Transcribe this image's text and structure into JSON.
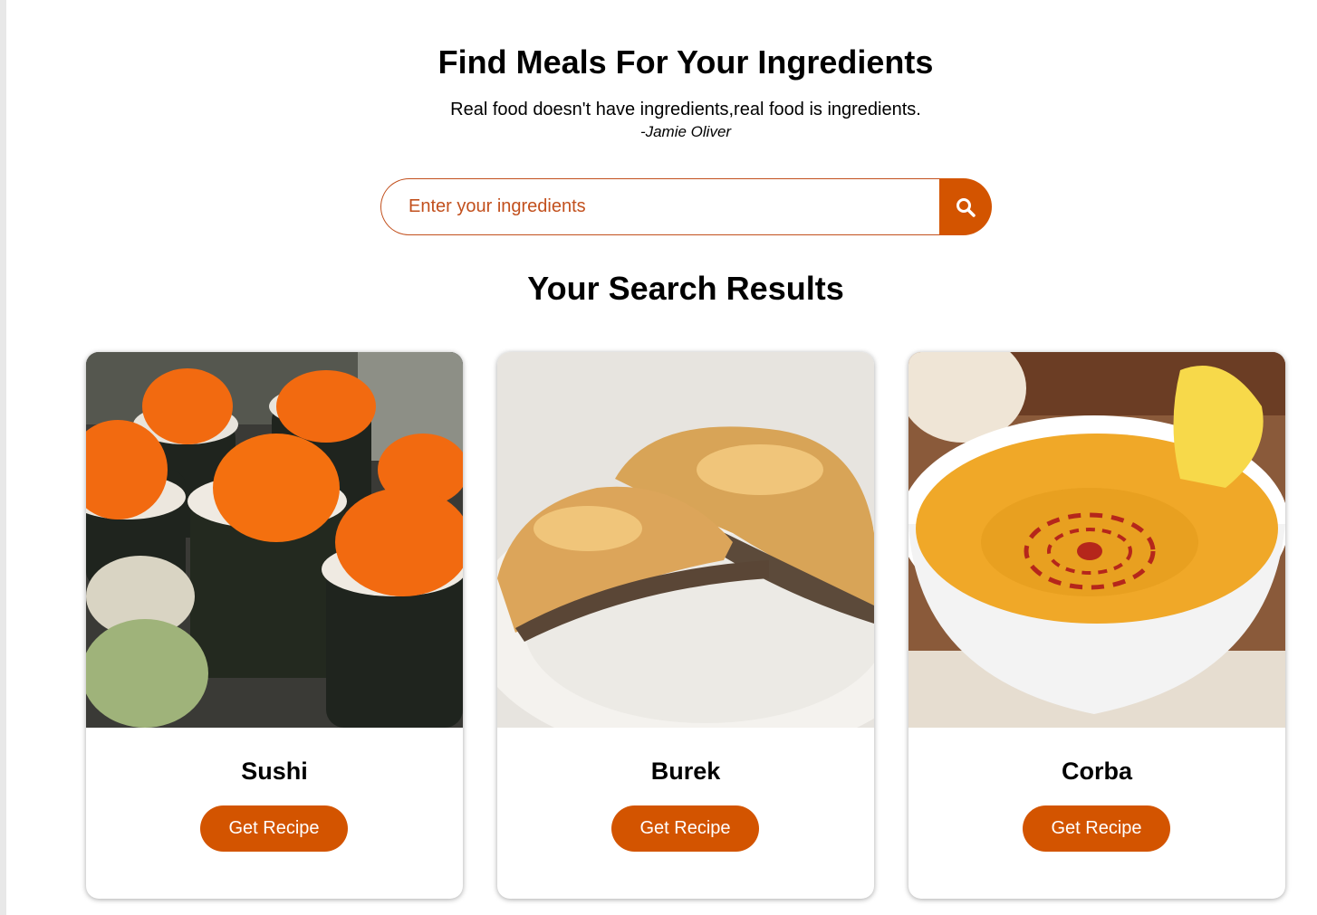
{
  "header": {
    "title": "Find Meals For Your Ingredients",
    "quote": "Real food doesn't have ingredients,real food is ingredients.",
    "quote_author": "-Jamie Oliver"
  },
  "search": {
    "placeholder": "Enter your ingredients",
    "icon": "search-icon"
  },
  "results": {
    "title": "Your Search Results",
    "meals": [
      {
        "name": "Sushi",
        "button_label": "Get Recipe"
      },
      {
        "name": "Burek",
        "button_label": "Get Recipe"
      },
      {
        "name": "Corba",
        "button_label": "Get Recipe"
      }
    ]
  },
  "colors": {
    "accent": "#d35400",
    "input_border": "#c2501d"
  }
}
